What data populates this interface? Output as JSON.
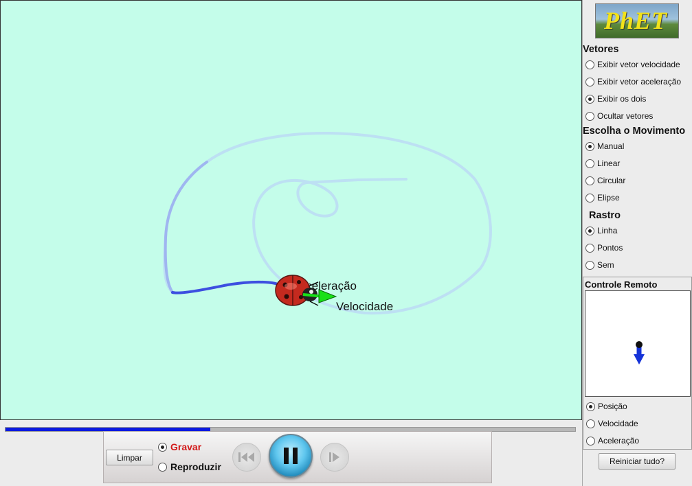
{
  "simulation": {
    "acceleration_label": "Aceleração",
    "velocity_label": "Velocidade"
  },
  "bottom": {
    "timeline_progress": 0.36,
    "clear_label": "Limpar",
    "record_label": "Gravar",
    "playback_label": "Reproduzir",
    "record_color": "#d21818",
    "rewind_icon": "rewind-icon",
    "pause_icon": "pause-icon",
    "step_icon": "step-forward-icon"
  },
  "sidebar": {
    "logo_text": "PhET",
    "vectors": {
      "title": "Vetores",
      "options": [
        "Exibir vetor velocidade",
        "Exibir vetor aceleração",
        "Exibir os dois",
        "Ocultar vetores"
      ],
      "selected": 2
    },
    "motion": {
      "title": "Escolha o Movimento",
      "options": [
        "Manual",
        "Linear",
        "Circular",
        "Elipse"
      ],
      "selected": 0
    },
    "trace": {
      "title": "Rastro",
      "options": [
        "Linha",
        "Pontos",
        "Sem"
      ],
      "selected": 0
    },
    "remote": {
      "title": "Controle Remoto",
      "options": [
        "Posição",
        "Velocidade",
        "Aceleração"
      ],
      "selected": 0
    },
    "reset_label": "Reiniciar tudo?"
  },
  "colors": {
    "play_background": "#c4fdea",
    "trail_recent": "#3d4fe0",
    "trail_old": "#bfdcf2",
    "velocity_vector": "#18e018",
    "remote_arrow": "#1533d8"
  }
}
